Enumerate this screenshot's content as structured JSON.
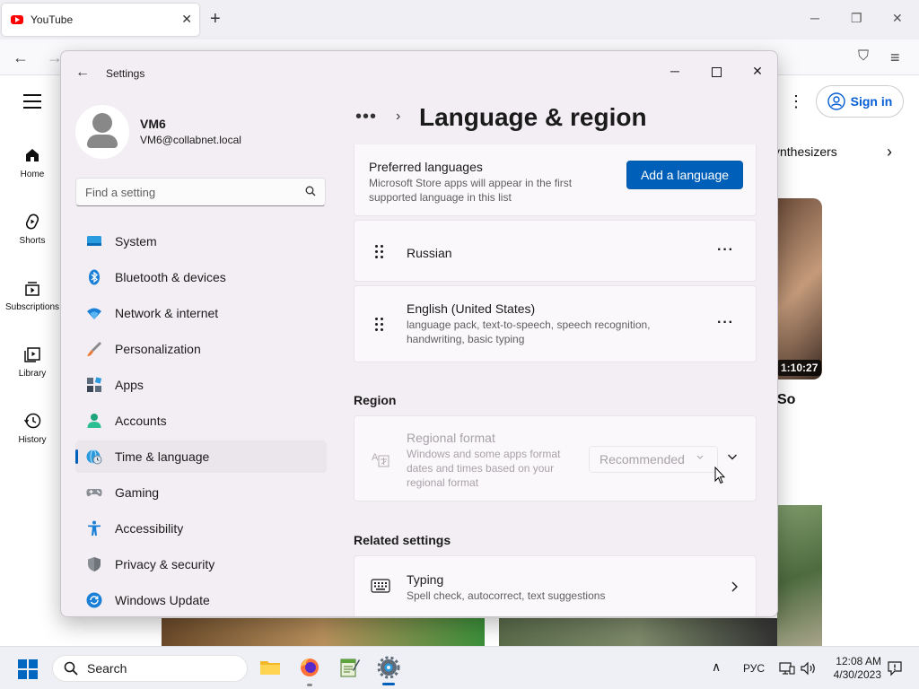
{
  "browser": {
    "tab_title": "YouTube",
    "tab_close": "✕",
    "new_tab": "+",
    "win_min": "─",
    "win_restore": "❐",
    "win_close": "✕",
    "nav_back": "←",
    "nav_forward": "→",
    "pocket": "⛉",
    "menu": "≡"
  },
  "youtube": {
    "sidebar": [
      {
        "label": "Home",
        "icon": "home-icon"
      },
      {
        "label": "Shorts",
        "icon": "shorts-icon"
      },
      {
        "label": "Subscriptions",
        "icon": "subscriptions-icon"
      },
      {
        "label": "Library",
        "icon": "library-icon"
      },
      {
        "label": "History",
        "icon": "history-icon"
      }
    ],
    "sign_in": "Sign in",
    "kebab": "⋮",
    "chip_text": "ynthesizers",
    "chip_arrow": "›",
    "duration": "1:10:27",
    "video_title_fragment": "So"
  },
  "settings": {
    "window_title": "Settings",
    "back": "←",
    "min": "─",
    "close": "✕",
    "user": {
      "name": "VM6",
      "email": "VM6@collabnet.local"
    },
    "search_placeholder": "Find a setting",
    "nav": [
      {
        "label": "System",
        "icon": "system-icon",
        "color": "#0078d4"
      },
      {
        "label": "Bluetooth & devices",
        "icon": "bluetooth-icon",
        "color": "#0078d4"
      },
      {
        "label": "Network & internet",
        "icon": "wifi-icon",
        "color": "#0078d4"
      },
      {
        "label": "Personalization",
        "icon": "paintbrush-icon",
        "color": "#e97b3a"
      },
      {
        "label": "Apps",
        "icon": "apps-icon",
        "color": "#5a6b7b"
      },
      {
        "label": "Accounts",
        "icon": "accounts-icon",
        "color": "#1fa37b"
      },
      {
        "label": "Time & language",
        "icon": "globe-clock-icon",
        "color": "#0078d4"
      },
      {
        "label": "Gaming",
        "icon": "gamepad-icon",
        "color": "#7a7a7a"
      },
      {
        "label": "Accessibility",
        "icon": "accessibility-icon",
        "color": "#0078d4"
      },
      {
        "label": "Privacy & security",
        "icon": "shield-icon",
        "color": "#7a7a7a"
      },
      {
        "label": "Windows Update",
        "icon": "update-icon",
        "color": "#0078d4"
      }
    ],
    "active_nav": "Time & language",
    "breadcrumb_dots": "•••",
    "breadcrumb_chevron": "›",
    "page_title": "Language & region",
    "preferred": {
      "title": "Preferred languages",
      "desc_line1": "Microsoft Store apps will appear in the first",
      "desc_line2": "supported language in this list",
      "add_button": "Add a language"
    },
    "languages": [
      {
        "name": "Russian",
        "desc_line1": "",
        "desc_line2": "",
        "more": "···"
      },
      {
        "name": "English (United States)",
        "desc_line1": "language pack, text-to-speech, speech recognition,",
        "desc_line2": "handwriting, basic typing",
        "more": "···"
      }
    ],
    "region": {
      "section_label": "Region",
      "title": "Regional format",
      "desc_line1": "Windows and some apps format",
      "desc_line2": "dates and times based on your",
      "desc_line3": "regional format",
      "dropdown_value": "Recommended",
      "enabled": false
    },
    "related": {
      "section_label": "Related settings",
      "typing_title": "Typing",
      "typing_desc": "Spell check, autocorrect, text suggestions"
    }
  },
  "taskbar": {
    "search_label": "Search",
    "lang": "РУС",
    "time": "12:08 AM",
    "date": "4/30/2023",
    "tray_chevron": "∧",
    "accent": "#0067c0"
  }
}
